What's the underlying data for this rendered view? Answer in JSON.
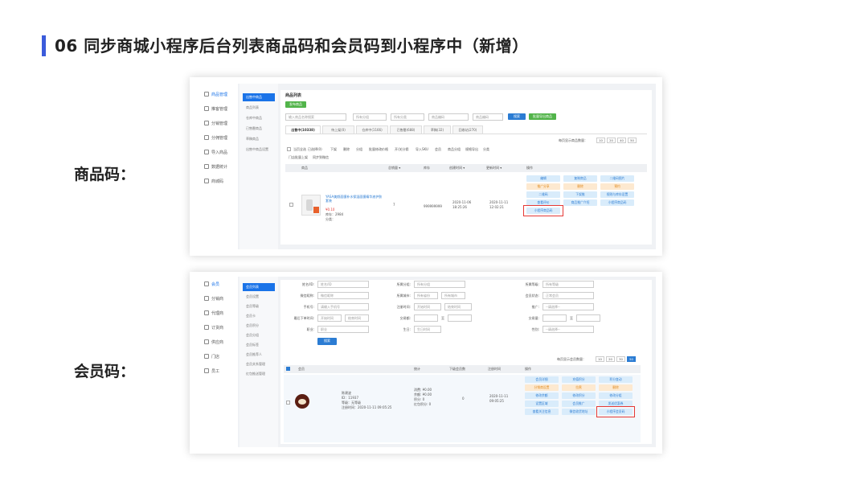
{
  "slide": {
    "title": "06 同步商城小程序后台列表商品码和会员码到小程序中（新增）",
    "label_product": "商品码：",
    "label_member": "会员码：",
    "accent_color": "#3b5bdb"
  },
  "product_shot": {
    "sidebar": [
      "商品管理",
      "推客管理",
      "分销管理",
      "分佣管理",
      "导入商品",
      "数据统计",
      "商城码"
    ],
    "subnav": [
      "出售中商品",
      "商品列表",
      "仓库中商品",
      "已售罄商品",
      "草稿商品",
      "出售中商品设置"
    ],
    "panel_title": "商品列表",
    "add_button": "发布商品",
    "search_placeholder": "输入商品名称搜索",
    "filter_group": "所有分组",
    "filter_type": "所有分类",
    "filter_code": "商品编码",
    "filter_barcode": "商品编码",
    "search_button": "搜索",
    "export_button": "批量导出商品",
    "tabs": [
      "出售中(10338)",
      "待上架(0)",
      "仓库中(1166)",
      "已售罄(688)",
      "草稿(32)",
      "回收站(270)"
    ],
    "page_size_label": "每页显示商品数量：",
    "page_sizes": [
      "10",
      "20",
      "40",
      "50"
    ],
    "bulk_actions": [
      "当页全选",
      "已选择(0)",
      "下架",
      "删除",
      "分组",
      "批量修改价格",
      "开/关分佣",
      "导入SKU",
      "会员",
      "商品分组",
      "规格导出",
      "分类"
    ],
    "bulk_actions_row2": [
      "门店批量上架",
      "同步到微信"
    ],
    "columns": [
      "商品",
      "总销量 ▾",
      "库存",
      "创建时间 ▾",
      "更新时间 ▾",
      "操作"
    ],
    "row": {
      "name": "YASA美颜面膜补水保湿面膜精华液护肤套装",
      "price": "¥0.10",
      "stock_label": "库存：2984",
      "category_label": "分类：",
      "sales": "7",
      "inventory": "999999999",
      "created": "2020-11-06 18:25:26",
      "updated": "2020-11-11 12:02:21"
    },
    "ops": [
      "编辑",
      "复制商品",
      "二维码图片",
      "推广分享",
      "删除",
      "预约",
      "二维码",
      "下架推",
      "规则与库存设置",
      "查看评价",
      "商品推广介绍",
      "小程序商品码",
      "小程序商品码"
    ],
    "highlight_label": "小程序商品码"
  },
  "member_shot": {
    "sidebar": [
      "会员",
      "分销商",
      "代理商",
      "订货商",
      "供应商",
      "门店",
      "员工"
    ],
    "subnav": [
      "会员列表",
      "会员设置",
      "会员等级",
      "会员卡",
      "会员积分",
      "会员分组",
      "会员标签",
      "会员推荐人",
      "会员关系管理",
      "红包推送管理"
    ],
    "fields": [
      {
        "label": "姓名/ID:",
        "placeholder": "姓名/ID"
      },
      {
        "label": "所属分组:",
        "placeholder": "所有分组"
      },
      {
        "label": "所属等级:",
        "placeholder": "所有等级"
      },
      {
        "label": "微信昵称:",
        "placeholder": "微信昵称"
      },
      {
        "label": "所属城市:",
        "placeholder": "所有省份"
      },
      {
        "label": "会员状态:",
        "placeholder": "正常会员"
      },
      {
        "label": "手机号:",
        "placeholder": "请输入手机号"
      },
      {
        "label": "注册时间:",
        "placeholder": "开始时间"
      },
      {
        "label": "推广:",
        "placeholder": "--请选择--"
      },
      {
        "label": "最后下单时间:",
        "placeholder": "开始时间"
      },
      {
        "label": "交易额:",
        "placeholder": ""
      },
      {
        "label": "交易量:",
        "placeholder": ""
      },
      {
        "label": "职业:",
        "placeholder": "职业"
      },
      {
        "label": "生日:",
        "placeholder": "生日时间"
      },
      {
        "label": "性别:",
        "placeholder": "--请选择--"
      }
    ],
    "city_placeholder": "所有城市",
    "end_placeholder": "结束时间",
    "to_label": "至",
    "search_button": "搜索",
    "page_size_label": "每页显示会员数量：",
    "page_sizes": [
      "10",
      "20",
      "30",
      "50"
    ],
    "columns": [
      "会员",
      "统计",
      "下级会员数",
      "注册时间",
      "操作"
    ],
    "row": {
      "name": "陈建波",
      "id": "ID：11937",
      "level": "等级：无等级",
      "reg": "注册时间：2020-11-11 09:05:25",
      "stat1": "消费: ¥0.00",
      "stat2": "余额: ¥0.00",
      "stat3": "积分: 0",
      "stat4": "红包积分: 0",
      "subcount": "0",
      "time": "2020-11-11 09:05:25"
    },
    "ops": [
      "会员详细",
      "充值积分",
      "积分变动",
      "分销商设置",
      "拉黑",
      "删除",
      "修改余额",
      "修改积分",
      "修改分组",
      "设置区域",
      "会员推广",
      "发送优惠券",
      "查看关注信息",
      "小程序会员码",
      "微信收货地址"
    ],
    "highlight_label": "小程序会员码"
  }
}
